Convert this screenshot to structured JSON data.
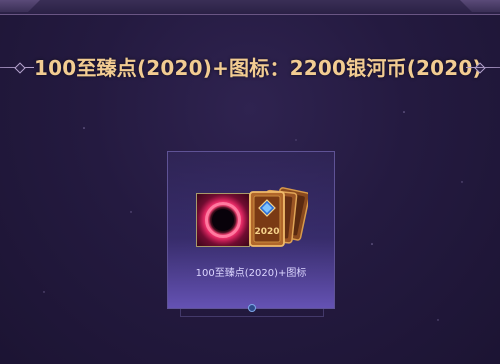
{
  "reward_title": "100至臻点(2020)+图标：2200银河币(2020)",
  "reward_card": {
    "label": "100至臻点(2020)+图标",
    "icon_year": "2020",
    "icons": [
      "prestige-points-vortex-icon",
      "2020-icon-frames-icon"
    ]
  },
  "colors": {
    "background": "#241a40",
    "title_gold": "#f2cc92",
    "card_border": "#5f5396",
    "card_glow": "#705cc8",
    "label": "#dcd6ff"
  }
}
